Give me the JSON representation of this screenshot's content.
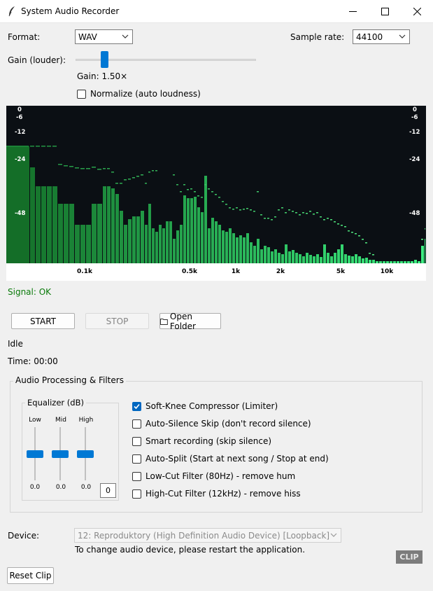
{
  "window": {
    "title": "System Audio Recorder"
  },
  "format": {
    "label": "Format:",
    "value": "WAV"
  },
  "sample_rate": {
    "label": "Sample rate:",
    "value": "44100"
  },
  "gain": {
    "label": "Gain (louder):",
    "readout": "Gain: 1.50×",
    "value": 1.5
  },
  "normalize": {
    "label": "Normalize (auto loudness)",
    "checked": false
  },
  "spectrum": {
    "db_labels_left": [
      "0",
      "-6",
      "-12",
      "-24",
      "-48"
    ],
    "db_labels_right": [
      "0",
      "-6",
      "-12",
      "-24",
      "-48"
    ],
    "freq_labels": [
      "0.1k",
      "0.5k",
      "1k",
      "2k",
      "5k",
      "10k"
    ]
  },
  "signal": {
    "text": "Signal: OK",
    "color": "#0a7a0a"
  },
  "controls": {
    "start": "START",
    "stop": "STOP",
    "open_folder": "Open Folder"
  },
  "status": {
    "state": "Idle",
    "time": "Time: 00:00"
  },
  "processing": {
    "title": "Audio Processing & Filters",
    "equalizer": {
      "title": "Equalizer (dB)",
      "bands": [
        {
          "label": "Low",
          "value": "0.0"
        },
        {
          "label": "Mid",
          "value": "0.0"
        },
        {
          "label": "High",
          "value": "0.0"
        }
      ],
      "preset_value": "0"
    },
    "options": [
      {
        "label": "Soft-Knee Compressor (Limiter)",
        "checked": true
      },
      {
        "label": "Auto-Silence Skip (don't record silence)",
        "checked": false
      },
      {
        "label": "Smart recording (skip silence)",
        "checked": false
      },
      {
        "label": "Auto-Split (Start at next song / Stop at end)",
        "checked": false
      },
      {
        "label": "Low-Cut Filter (80Hz) - remove hum",
        "checked": false
      },
      {
        "label": "High-Cut Filter (12kHz) - remove hiss",
        "checked": false
      }
    ]
  },
  "device": {
    "label": "Device:",
    "value": "12: Reproduktory (High Definition Audio Device) [Loopback]",
    "hint": "To change audio device, please restart the application."
  },
  "clip_badge": "CLIP",
  "reset_clip": "Reset Clip"
}
